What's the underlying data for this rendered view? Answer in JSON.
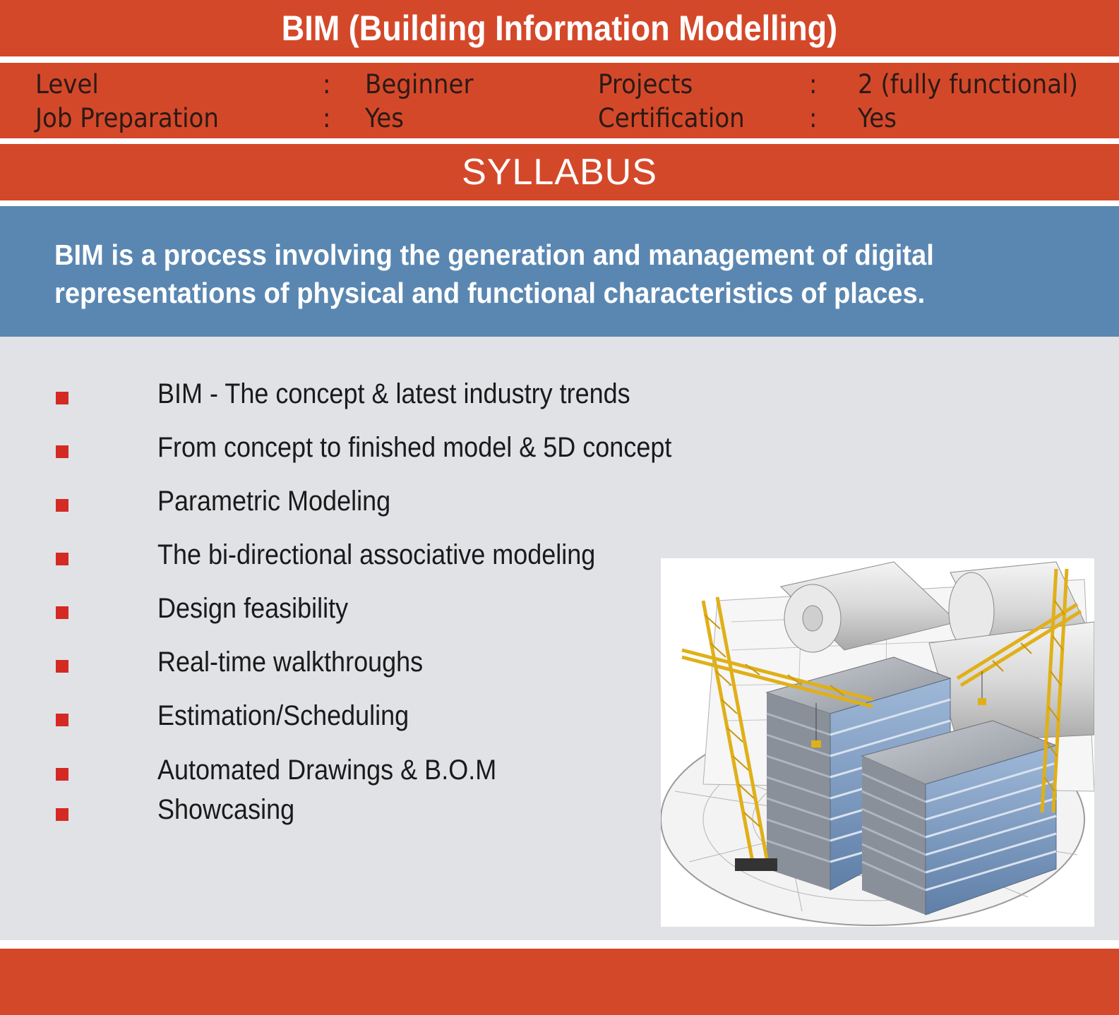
{
  "header": {
    "title": "BIM (Building Information Modelling)"
  },
  "info": {
    "level_label": "Level",
    "level_value": "Beginner",
    "job_label": "Job Preparation",
    "job_value": "Yes",
    "projects_label": "Projects",
    "projects_value": "2 (fully functional)",
    "cert_label": "Certification",
    "cert_value": "Yes",
    "separator": ":"
  },
  "syllabus": {
    "heading": "SYLLABUS",
    "intro": "BIM is a process involving the generation and management of digital representations of physical and functional characteristics of places.",
    "items": [
      "BIM - The concept & latest industry trends",
      "From concept to finished model & 5D concept",
      "Parametric Modeling",
      "The bi-directional associative modeling",
      "Design feasibility",
      "Real-time walkthroughs",
      "Estimation/Scheduling",
      "Automated Drawings & B.O.M",
      "Showcasing"
    ]
  },
  "colors": {
    "accent_red": "#d4482a",
    "intro_blue": "#5a87b1",
    "panel_gray": "#e1e2e6",
    "bullet_red": "#d42a24"
  },
  "illustration": {
    "icon": "construction-cranes-building-illustration"
  }
}
